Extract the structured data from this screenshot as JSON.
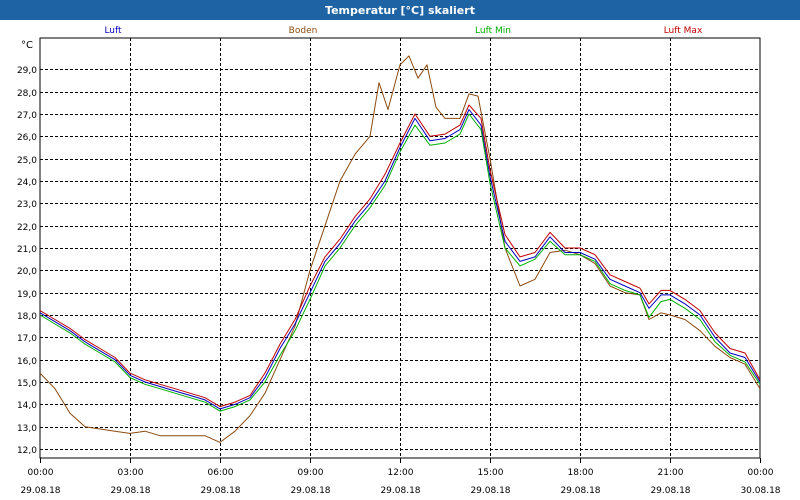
{
  "window": {
    "title": "Temperatur [°C] skaliert"
  },
  "colors": {
    "titlebar": "#1e64a5",
    "grid": "#000000",
    "luft": "#0000c0",
    "boden": "#8b4a10",
    "luft_min": "#00b000",
    "luft_max": "#c00000"
  },
  "chart_data": {
    "type": "line",
    "title": "",
    "ylabel": "°C",
    "xlabel": "",
    "grid": true,
    "legend_placement": "top",
    "ylim": [
      11.6,
      30.4
    ],
    "xlim": [
      0,
      24
    ],
    "y_ticks": [
      "12,0",
      "13,0",
      "14,0",
      "15,0",
      "16,0",
      "17,0",
      "18,0",
      "19,0",
      "20,0",
      "21,0",
      "22,0",
      "23,0",
      "24,0",
      "25,0",
      "26,0",
      "27,0",
      "28,0",
      "29,0"
    ],
    "x_tick_values": [
      0,
      3,
      6,
      9,
      12,
      15,
      18,
      21,
      24
    ],
    "x_tick_times": [
      "00:00",
      "03:00",
      "06:00",
      "09:00",
      "12:00",
      "15:00",
      "18:00",
      "21:00",
      "00:00"
    ],
    "x_tick_dates": [
      "29.08.18",
      "29.08.18",
      "29.08.18",
      "29.08.18",
      "29.08.18",
      "29.08.18",
      "29.08.18",
      "29.08.18",
      "30.08.18"
    ],
    "series": [
      {
        "name": "Luft",
        "color": "#0000c0",
        "points": [
          [
            0,
            18.1
          ],
          [
            0.5,
            17.7
          ],
          [
            1,
            17.3
          ],
          [
            1.5,
            16.8
          ],
          [
            2,
            16.4
          ],
          [
            2.5,
            16.0
          ],
          [
            3,
            15.3
          ],
          [
            3.5,
            15.0
          ],
          [
            4,
            14.8
          ],
          [
            4.5,
            14.6
          ],
          [
            5,
            14.4
          ],
          [
            5.5,
            14.2
          ],
          [
            6,
            13.8
          ],
          [
            6.5,
            14.0
          ],
          [
            7,
            14.3
          ],
          [
            7.5,
            15.2
          ],
          [
            8,
            16.5
          ],
          [
            8.5,
            17.6
          ],
          [
            9,
            19.0
          ],
          [
            9.5,
            20.4
          ],
          [
            10,
            21.2
          ],
          [
            10.5,
            22.2
          ],
          [
            11,
            23.0
          ],
          [
            11.5,
            24.0
          ],
          [
            12,
            25.5
          ],
          [
            12.5,
            26.8
          ],
          [
            13,
            25.8
          ],
          [
            13.5,
            25.9
          ],
          [
            14,
            26.3
          ],
          [
            14.3,
            27.2
          ],
          [
            14.7,
            26.5
          ],
          [
            15,
            24.2
          ],
          [
            15.5,
            21.3
          ],
          [
            16,
            20.4
          ],
          [
            16.5,
            20.6
          ],
          [
            17,
            21.5
          ],
          [
            17.5,
            20.8
          ],
          [
            18,
            20.8
          ],
          [
            18.5,
            20.5
          ],
          [
            19,
            19.6
          ],
          [
            19.5,
            19.3
          ],
          [
            20,
            19.0
          ],
          [
            20.3,
            18.3
          ],
          [
            20.7,
            18.9
          ],
          [
            21,
            18.9
          ],
          [
            21.5,
            18.5
          ],
          [
            22,
            18.0
          ],
          [
            22.5,
            17.0
          ],
          [
            23,
            16.3
          ],
          [
            23.5,
            16.1
          ],
          [
            24,
            15.0
          ]
        ]
      },
      {
        "name": "Boden",
        "color": "#8b4a10",
        "points": [
          [
            0,
            15.4
          ],
          [
            0.5,
            14.7
          ],
          [
            1,
            13.6
          ],
          [
            1.5,
            13.0
          ],
          [
            2,
            12.9
          ],
          [
            2.5,
            12.8
          ],
          [
            3,
            12.7
          ],
          [
            3.5,
            12.8
          ],
          [
            4,
            12.6
          ],
          [
            4.5,
            12.6
          ],
          [
            5,
            12.6
          ],
          [
            5.5,
            12.6
          ],
          [
            6,
            12.3
          ],
          [
            6.5,
            12.8
          ],
          [
            7,
            13.5
          ],
          [
            7.5,
            14.5
          ],
          [
            8,
            16.0
          ],
          [
            8.5,
            17.5
          ],
          [
            9,
            20.0
          ],
          [
            9.5,
            22.0
          ],
          [
            10,
            24.0
          ],
          [
            10.5,
            25.2
          ],
          [
            11,
            26.0
          ],
          [
            11.3,
            28.4
          ],
          [
            11.6,
            27.2
          ],
          [
            12,
            29.2
          ],
          [
            12.3,
            29.6
          ],
          [
            12.6,
            28.6
          ],
          [
            12.9,
            29.2
          ],
          [
            13.2,
            27.3
          ],
          [
            13.5,
            26.8
          ],
          [
            14,
            26.8
          ],
          [
            14.3,
            27.9
          ],
          [
            14.6,
            27.8
          ],
          [
            15,
            25.0
          ],
          [
            15.5,
            21.0
          ],
          [
            16,
            19.3
          ],
          [
            16.5,
            19.6
          ],
          [
            17,
            20.8
          ],
          [
            17.5,
            20.9
          ],
          [
            18,
            20.7
          ],
          [
            18.5,
            20.3
          ],
          [
            19,
            19.3
          ],
          [
            19.5,
            19.0
          ],
          [
            20,
            18.9
          ],
          [
            20.3,
            17.8
          ],
          [
            20.7,
            18.1
          ],
          [
            21,
            18.0
          ],
          [
            21.5,
            17.8
          ],
          [
            22,
            17.3
          ],
          [
            22.5,
            16.6
          ],
          [
            23,
            16.1
          ],
          [
            23.5,
            15.8
          ],
          [
            24,
            14.7
          ]
        ]
      },
      {
        "name": "Luft Min",
        "color": "#00b000",
        "points": [
          [
            0,
            18.0
          ],
          [
            0.5,
            17.6
          ],
          [
            1,
            17.2
          ],
          [
            1.5,
            16.7
          ],
          [
            2,
            16.3
          ],
          [
            2.5,
            15.9
          ],
          [
            3,
            15.2
          ],
          [
            3.5,
            14.9
          ],
          [
            4,
            14.7
          ],
          [
            4.5,
            14.5
          ],
          [
            5,
            14.3
          ],
          [
            5.5,
            14.1
          ],
          [
            6,
            13.7
          ],
          [
            6.5,
            13.9
          ],
          [
            7,
            14.2
          ],
          [
            7.5,
            15.0
          ],
          [
            8,
            16.2
          ],
          [
            8.5,
            17.3
          ],
          [
            9,
            18.7
          ],
          [
            9.5,
            20.2
          ],
          [
            10,
            21.0
          ],
          [
            10.5,
            22.0
          ],
          [
            11,
            22.8
          ],
          [
            11.5,
            23.8
          ],
          [
            12,
            25.3
          ],
          [
            12.5,
            26.5
          ],
          [
            13,
            25.6
          ],
          [
            13.5,
            25.7
          ],
          [
            14,
            26.1
          ],
          [
            14.3,
            27.0
          ],
          [
            14.7,
            26.3
          ],
          [
            15,
            23.9
          ],
          [
            15.5,
            21.0
          ],
          [
            16,
            20.2
          ],
          [
            16.5,
            20.5
          ],
          [
            17,
            21.3
          ],
          [
            17.5,
            20.7
          ],
          [
            18,
            20.7
          ],
          [
            18.5,
            20.4
          ],
          [
            19,
            19.4
          ],
          [
            19.5,
            19.1
          ],
          [
            20,
            18.9
          ],
          [
            20.3,
            17.9
          ],
          [
            20.7,
            18.6
          ],
          [
            21,
            18.7
          ],
          [
            21.5,
            18.3
          ],
          [
            22,
            17.8
          ],
          [
            22.5,
            16.8
          ],
          [
            23,
            16.2
          ],
          [
            23.5,
            15.9
          ],
          [
            24,
            14.9
          ]
        ]
      },
      {
        "name": "Luft Max",
        "color": "#c00000",
        "points": [
          [
            0,
            18.2
          ],
          [
            0.5,
            17.8
          ],
          [
            1,
            17.4
          ],
          [
            1.5,
            16.9
          ],
          [
            2,
            16.5
          ],
          [
            2.5,
            16.1
          ],
          [
            3,
            15.4
          ],
          [
            3.5,
            15.1
          ],
          [
            4,
            14.9
          ],
          [
            4.5,
            14.7
          ],
          [
            5,
            14.5
          ],
          [
            5.5,
            14.3
          ],
          [
            6,
            13.9
          ],
          [
            6.5,
            14.1
          ],
          [
            7,
            14.4
          ],
          [
            7.5,
            15.4
          ],
          [
            8,
            16.7
          ],
          [
            8.5,
            17.8
          ],
          [
            9,
            19.3
          ],
          [
            9.5,
            20.6
          ],
          [
            10,
            21.4
          ],
          [
            10.5,
            22.4
          ],
          [
            11,
            23.2
          ],
          [
            11.5,
            24.3
          ],
          [
            12,
            25.7
          ],
          [
            12.5,
            27.0
          ],
          [
            13,
            26.0
          ],
          [
            13.5,
            26.1
          ],
          [
            14,
            26.5
          ],
          [
            14.3,
            27.4
          ],
          [
            14.7,
            26.8
          ],
          [
            15,
            24.5
          ],
          [
            15.5,
            21.6
          ],
          [
            16,
            20.6
          ],
          [
            16.5,
            20.8
          ],
          [
            17,
            21.7
          ],
          [
            17.5,
            21.0
          ],
          [
            18,
            21.0
          ],
          [
            18.5,
            20.7
          ],
          [
            19,
            19.8
          ],
          [
            19.5,
            19.5
          ],
          [
            20,
            19.2
          ],
          [
            20.3,
            18.5
          ],
          [
            20.7,
            19.1
          ],
          [
            21,
            19.1
          ],
          [
            21.5,
            18.7
          ],
          [
            22,
            18.2
          ],
          [
            22.5,
            17.2
          ],
          [
            23,
            16.5
          ],
          [
            23.5,
            16.3
          ],
          [
            24,
            15.1
          ]
        ]
      }
    ]
  }
}
